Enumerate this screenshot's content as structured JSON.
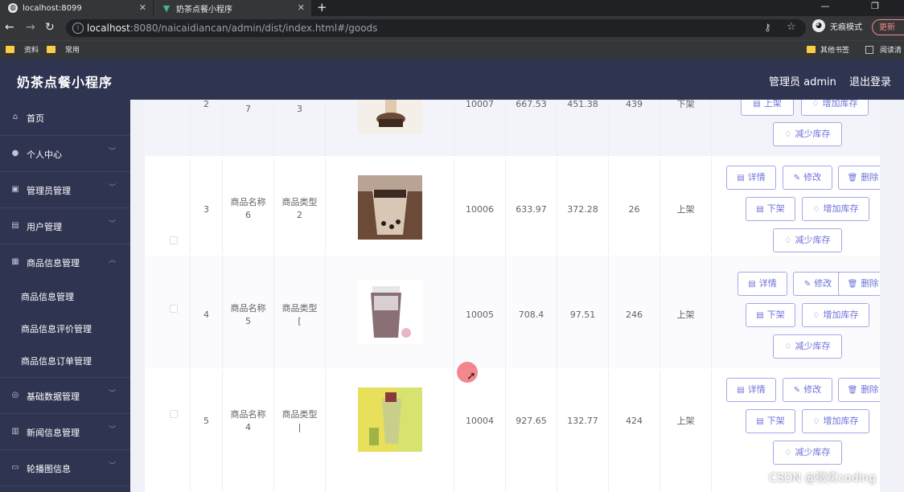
{
  "browser": {
    "tabs": [
      {
        "title": "localhost:8099",
        "icon": "globe-icon"
      },
      {
        "title": "奶茶点餐小程序",
        "icon": "vue-icon"
      }
    ],
    "url_host": "localhost",
    "url_rest": ":8080/naicaidiancan/admin/dist/index.html#/goods",
    "incognito_label": "无痕模式",
    "update_label": "更新",
    "bookmarks": [
      "资料",
      "常用"
    ],
    "bookmarks_right": [
      "其他书签",
      "阅读清"
    ]
  },
  "header": {
    "title": "奶茶点餐小程序",
    "admin": "管理员 admin",
    "logout": "退出登录"
  },
  "sidebar": {
    "items": [
      {
        "label": "首页",
        "icon": "home-icon",
        "expandable": false
      },
      {
        "label": "个人中心",
        "icon": "user-icon",
        "expandable": true
      },
      {
        "label": "管理员管理",
        "icon": "admin-icon",
        "expandable": true
      },
      {
        "label": "用户管理",
        "icon": "users-icon",
        "expandable": true
      },
      {
        "label": "商品信息管理",
        "icon": "goods-icon",
        "expandable": true,
        "expanded": true
      }
    ],
    "subitems": [
      "商品信息管理",
      "商品信息评价管理",
      "商品信息订单管理"
    ],
    "items_after": [
      {
        "label": "基础数据管理",
        "icon": "data-icon"
      },
      {
        "label": "新闻信息管理",
        "icon": "news-icon"
      },
      {
        "label": "轮播图信息",
        "icon": "carousel-icon"
      }
    ]
  },
  "table": {
    "rows": [
      {
        "index": "2",
        "name": "7",
        "type": "3",
        "code": "10007",
        "price": "667.53",
        "member_price": "451.38",
        "stock": "439",
        "status": "下架"
      },
      {
        "index": "3",
        "name": "商品名称\n6",
        "type": "商品类型\n2",
        "code": "10006",
        "price": "633.97",
        "member_price": "372.28",
        "stock": "26",
        "status": "上架"
      },
      {
        "index": "4",
        "name": "商品名称\n5",
        "type": "商品类型\n[",
        "code": "10005",
        "price": "708.4",
        "member_price": "97.51",
        "stock": "246",
        "status": "上架"
      },
      {
        "index": "5",
        "name": "商品名称\n4",
        "type": "商品类型\n|",
        "code": "10004",
        "price": "927.65",
        "member_price": "132.77",
        "stock": "424",
        "status": "上架"
      }
    ],
    "actions": {
      "detail": "详情",
      "edit": "修改",
      "delete": "删除",
      "off_shelf": "下架",
      "on_shelf": "上架",
      "add_stock": "增加库存",
      "reduce_stock": "减少库存"
    }
  },
  "watermark": "CSDN @微实coding"
}
